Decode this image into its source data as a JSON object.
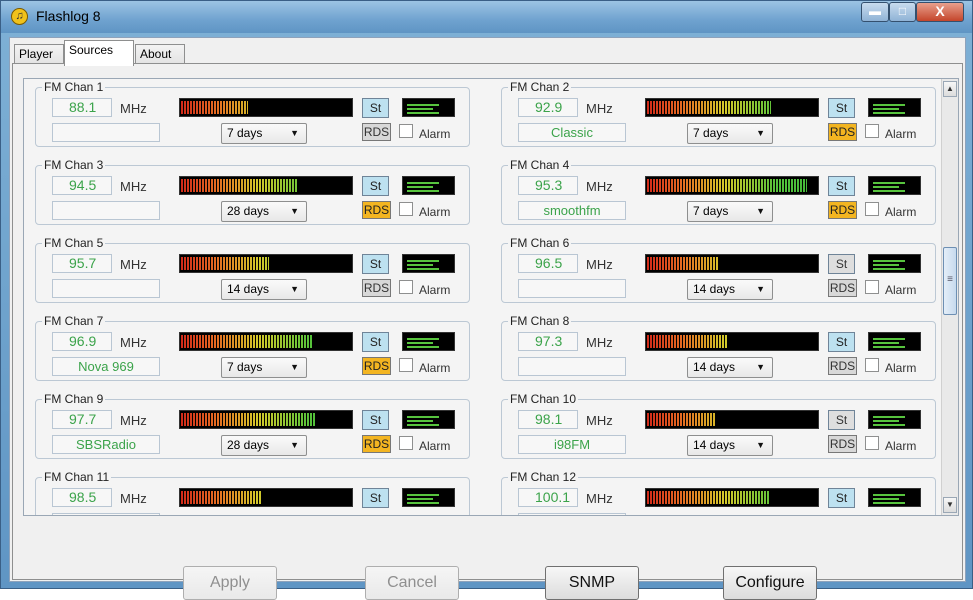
{
  "window": {
    "title": "Flashlog 8",
    "minimize": "▬",
    "maximize": "□",
    "close": "X"
  },
  "tabs": [
    {
      "label": "Player"
    },
    {
      "label": "Sources"
    },
    {
      "label": "About"
    }
  ],
  "labels": {
    "unit": "MHz",
    "stereo": "St",
    "rds": "RDS",
    "alarm": "Alarm"
  },
  "channels": [
    {
      "title": "FM Chan 1",
      "frequency": "88.1",
      "station": "",
      "days": "7 days",
      "signal_level": 0.39,
      "stereo": true,
      "rds": false,
      "alarm": false
    },
    {
      "title": "FM Chan 2",
      "frequency": "92.9",
      "station": "Classic",
      "days": "7 days",
      "signal_level": 0.72,
      "stereo": true,
      "rds": true,
      "alarm": false
    },
    {
      "title": "FM Chan 3",
      "frequency": "94.5",
      "station": "",
      "days": "28 days",
      "signal_level": 0.68,
      "stereo": true,
      "rds": true,
      "alarm": false
    },
    {
      "title": "FM Chan 4",
      "frequency": "95.3",
      "station": "smoothfm",
      "days": "7 days",
      "signal_level": 0.93,
      "stereo": true,
      "rds": true,
      "alarm": false
    },
    {
      "title": "FM Chan 5",
      "frequency": "95.7",
      "station": "",
      "days": "14 days",
      "signal_level": 0.51,
      "stereo": true,
      "rds": false,
      "alarm": false
    },
    {
      "title": "FM Chan 6",
      "frequency": "96.5",
      "station": "",
      "days": "14 days",
      "signal_level": 0.42,
      "stereo": false,
      "rds": false,
      "alarm": false
    },
    {
      "title": "FM Chan 7",
      "frequency": "96.9",
      "station": "Nova 969",
      "days": "7 days",
      "signal_level": 0.76,
      "stereo": true,
      "rds": true,
      "alarm": false
    },
    {
      "title": "FM Chan 8",
      "frequency": "97.3",
      "station": "",
      "days": "14 days",
      "signal_level": 0.47,
      "stereo": true,
      "rds": false,
      "alarm": false
    },
    {
      "title": "FM Chan 9",
      "frequency": "97.7",
      "station": "SBSRadio",
      "days": "28 days",
      "signal_level": 0.78,
      "stereo": true,
      "rds": true,
      "alarm": false
    },
    {
      "title": "FM Chan 10",
      "frequency": "98.1",
      "station": "i98FM",
      "days": "14 days",
      "signal_level": 0.4,
      "stereo": false,
      "rds": false,
      "alarm": false
    },
    {
      "title": "FM Chan 11",
      "frequency": "98.5",
      "station": "",
      "days": "",
      "signal_level": 0.47,
      "stereo": true,
      "rds": false,
      "alarm": false
    },
    {
      "title": "FM Chan 12",
      "frequency": "100.1",
      "station": "",
      "days": "",
      "signal_level": 0.71,
      "stereo": true,
      "rds": false,
      "alarm": false
    }
  ],
  "buttons": {
    "apply": "Apply",
    "cancel": "Cancel",
    "snmp": "SNMP",
    "configure": "Configure"
  }
}
